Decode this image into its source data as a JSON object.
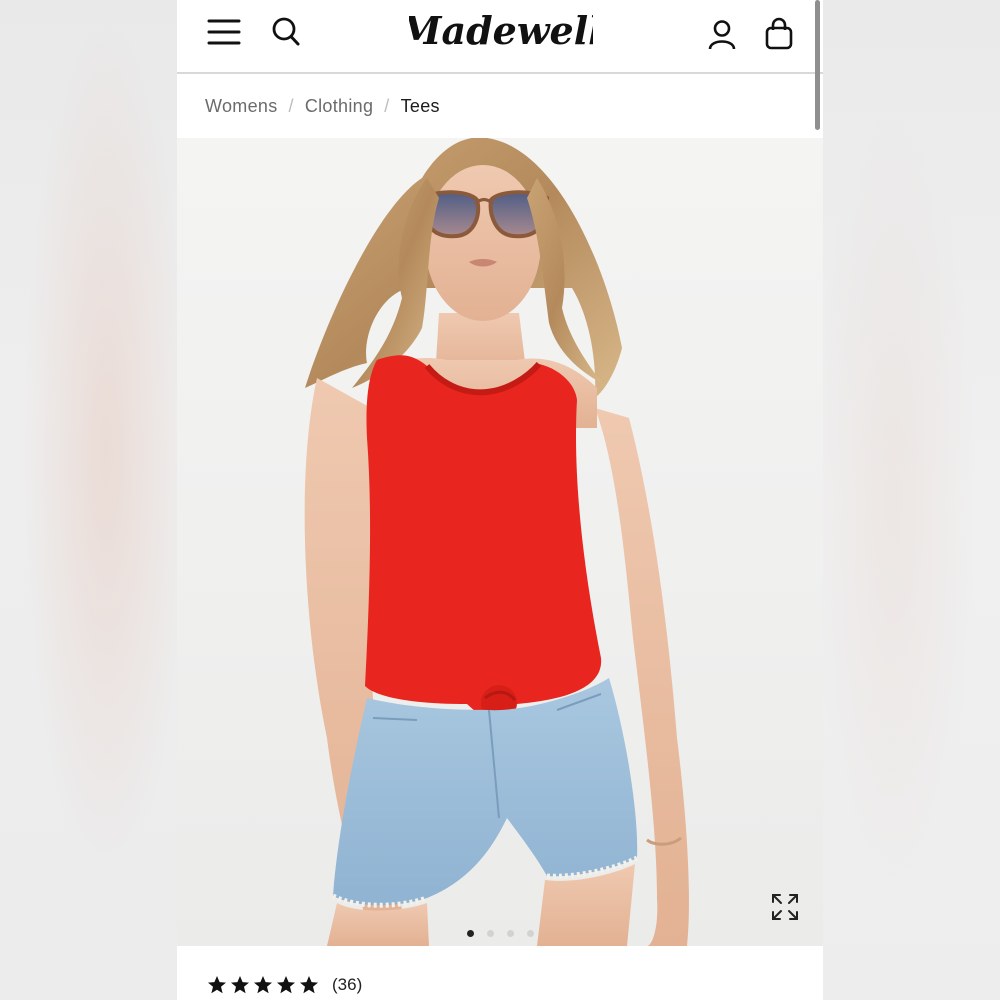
{
  "header": {
    "brand": "Madewell",
    "menu_icon": "hamburger-menu-icon",
    "search_icon": "search-icon",
    "account_icon": "account-icon",
    "bag_icon": "shopping-bag-icon"
  },
  "breadcrumb": {
    "items": [
      "Womens",
      "Clothing",
      "Tees"
    ],
    "separator": "/"
  },
  "product": {
    "image_icon": "product-photo",
    "gallery_total": 4,
    "gallery_active_index": 0,
    "expand_icon": "expand-icon",
    "rating": {
      "stars": 5,
      "count_label": "(36)"
    }
  },
  "colors": {
    "top_red": "#e8261f",
    "denim": "#9fc0dc",
    "text": "#1c1c1c"
  }
}
